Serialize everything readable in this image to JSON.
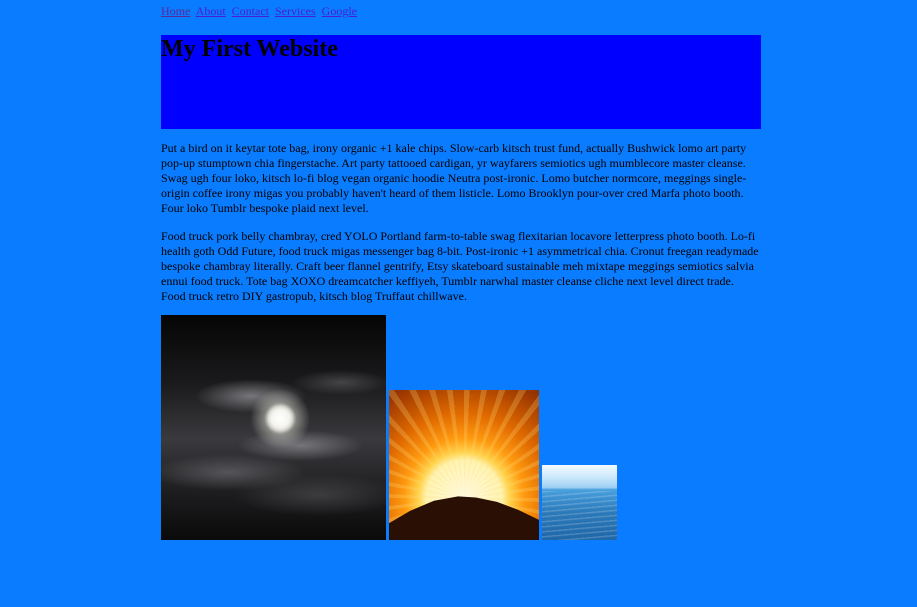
{
  "nav": {
    "links": [
      "Home",
      "About",
      "Contact",
      "Services",
      "Google"
    ]
  },
  "header": {
    "title": "My First Website"
  },
  "content": {
    "paragraph_1": "Put a bird on it keytar tote bag, irony organic +1 kale chips. Slow-carb kitsch trust fund, actually Bushwick lomo art party pop-up stumptown chia fingerstache. Art party tattooed cardigan, yr wayfarers semiotics ugh mumblecore master cleanse. Swag ugh four loko, kitsch lo-fi blog vegan organic hoodie Neutra post-ironic. Lomo butcher normcore, meggings single-origin coffee irony migas you probably haven't heard of them listicle. Lomo Brooklyn pour-over cred Marfa photo booth. Four loko Tumblr bespoke plaid next level.",
    "paragraph_2": "Food truck pork belly chambray, cred YOLO Portland farm-to-table swag flexitarian locavore letterpress photo booth. Lo-fi health goth Odd Future, food truck migas messenger bag 8-bit. Post-ironic +1 asymmetrical chia. Cronut freegan readymade bespoke chambray literally. Craft beer flannel gentrify, Etsy skateboard sustainable meh mixtape meggings semiotics salvia ennui food truck. Tote bag XOXO dreamcatcher keffiyeh, Tumblr narwhal master cleanse cliche next level direct trade. Food truck retro DIY gastropub, kitsch blog Truffaut chillwave."
  },
  "images": [
    {
      "name": "moon-image",
      "subject": "moon behind clouds at night"
    },
    {
      "name": "sun-image",
      "subject": "sun rising over hill"
    },
    {
      "name": "sea-image",
      "subject": "ocean and sky"
    }
  ],
  "colors": {
    "page_background": "#0a7cff",
    "header_background": "#0000ff",
    "link": "#4a1ecf"
  }
}
